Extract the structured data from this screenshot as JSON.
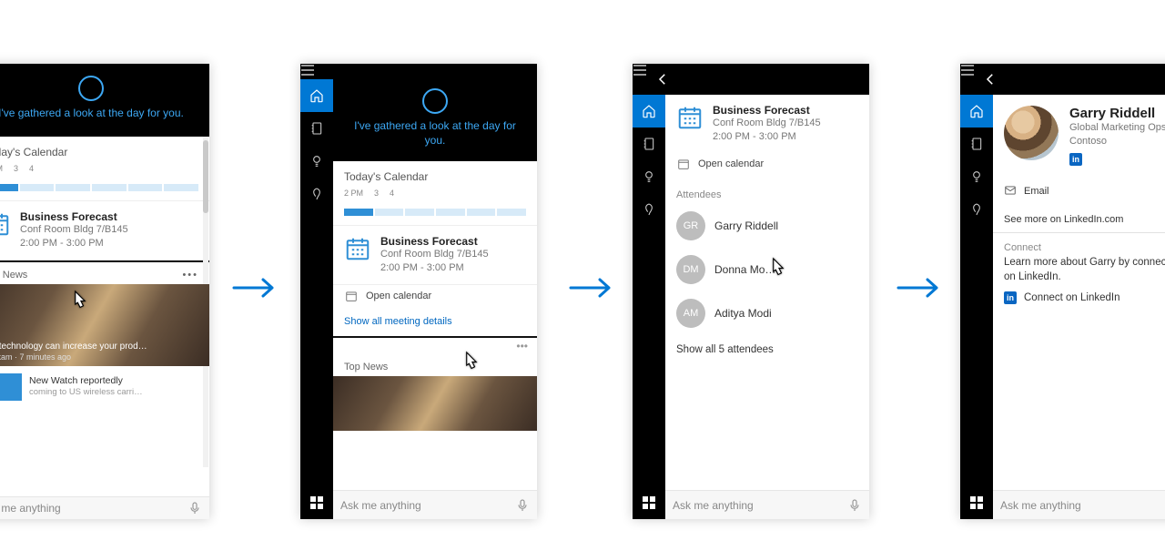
{
  "greeting": "I've gathered a look at the day for you.",
  "askbar_placeholder": "Ask me anything",
  "calendar": {
    "title": "Today's Calendar",
    "ticks": [
      "2 PM",
      "3",
      "4"
    ]
  },
  "meeting": {
    "title": "Business Forecast",
    "location": "Conf Room Bldg 7/B145",
    "time": "2:00 PM - 3:00 PM"
  },
  "open_calendar_label": "Open calendar",
  "show_all_details_label": "Show all meeting details",
  "news": {
    "section_label": "Top News",
    "headline": "How technology can increase your prod…",
    "source": "Fabrikam",
    "age": "7 minutes ago",
    "second_title": "New Watch reportedly",
    "second_sub": "coming to US wireless carri…"
  },
  "attendees": {
    "label": "Attendees",
    "list": [
      {
        "initials": "GR",
        "name": "Garry Riddell"
      },
      {
        "initials": "DM",
        "name": "Donna Mo…"
      },
      {
        "initials": "AM",
        "name": "Aditya Modi"
      }
    ],
    "show_all": "Show all 5 attendees"
  },
  "profile": {
    "name": "Garry Riddell",
    "title_line": "Global Marketing Ops |",
    "company": "Contoso",
    "email_label": "Email",
    "see_more": "See more on LinkedIn.com",
    "connect_label": "Connect",
    "connect_text": "Learn more about Garry by connecting on LinkedIn.",
    "connect_link": "Connect on LinkedIn"
  }
}
